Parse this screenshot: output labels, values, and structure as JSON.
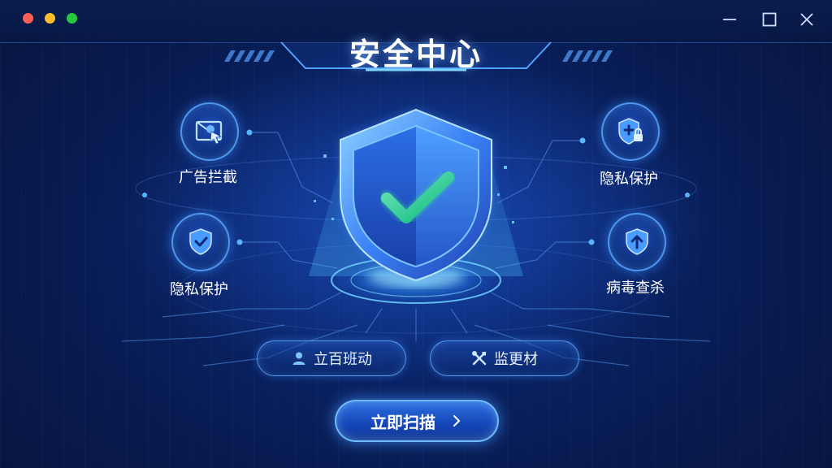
{
  "window": {
    "title": "安全中心",
    "traffic_lights": [
      "close",
      "minimize",
      "zoom"
    ],
    "controls": [
      "minimize-icon",
      "maximize-icon",
      "close-icon"
    ]
  },
  "features": [
    {
      "label": "广告拦截",
      "icon": "ad-block-icon"
    },
    {
      "label": "隐私保护",
      "icon": "shield-check-icon"
    },
    {
      "label": "隐私保护",
      "icon": "shield-lock-icon"
    },
    {
      "label": "病毒查杀",
      "icon": "shield-upload-icon"
    }
  ],
  "actions": [
    {
      "label": "立百班动",
      "icon": "user-icon"
    },
    {
      "label": "监更材",
      "icon": "tools-icon"
    }
  ],
  "primary_action": {
    "label": "立即扫描",
    "icon": "chevron-right-icon"
  },
  "colors": {
    "background": "#061233",
    "accent": "#2d6fe0",
    "check": "#34d399",
    "glow": "#5ab4ff"
  }
}
